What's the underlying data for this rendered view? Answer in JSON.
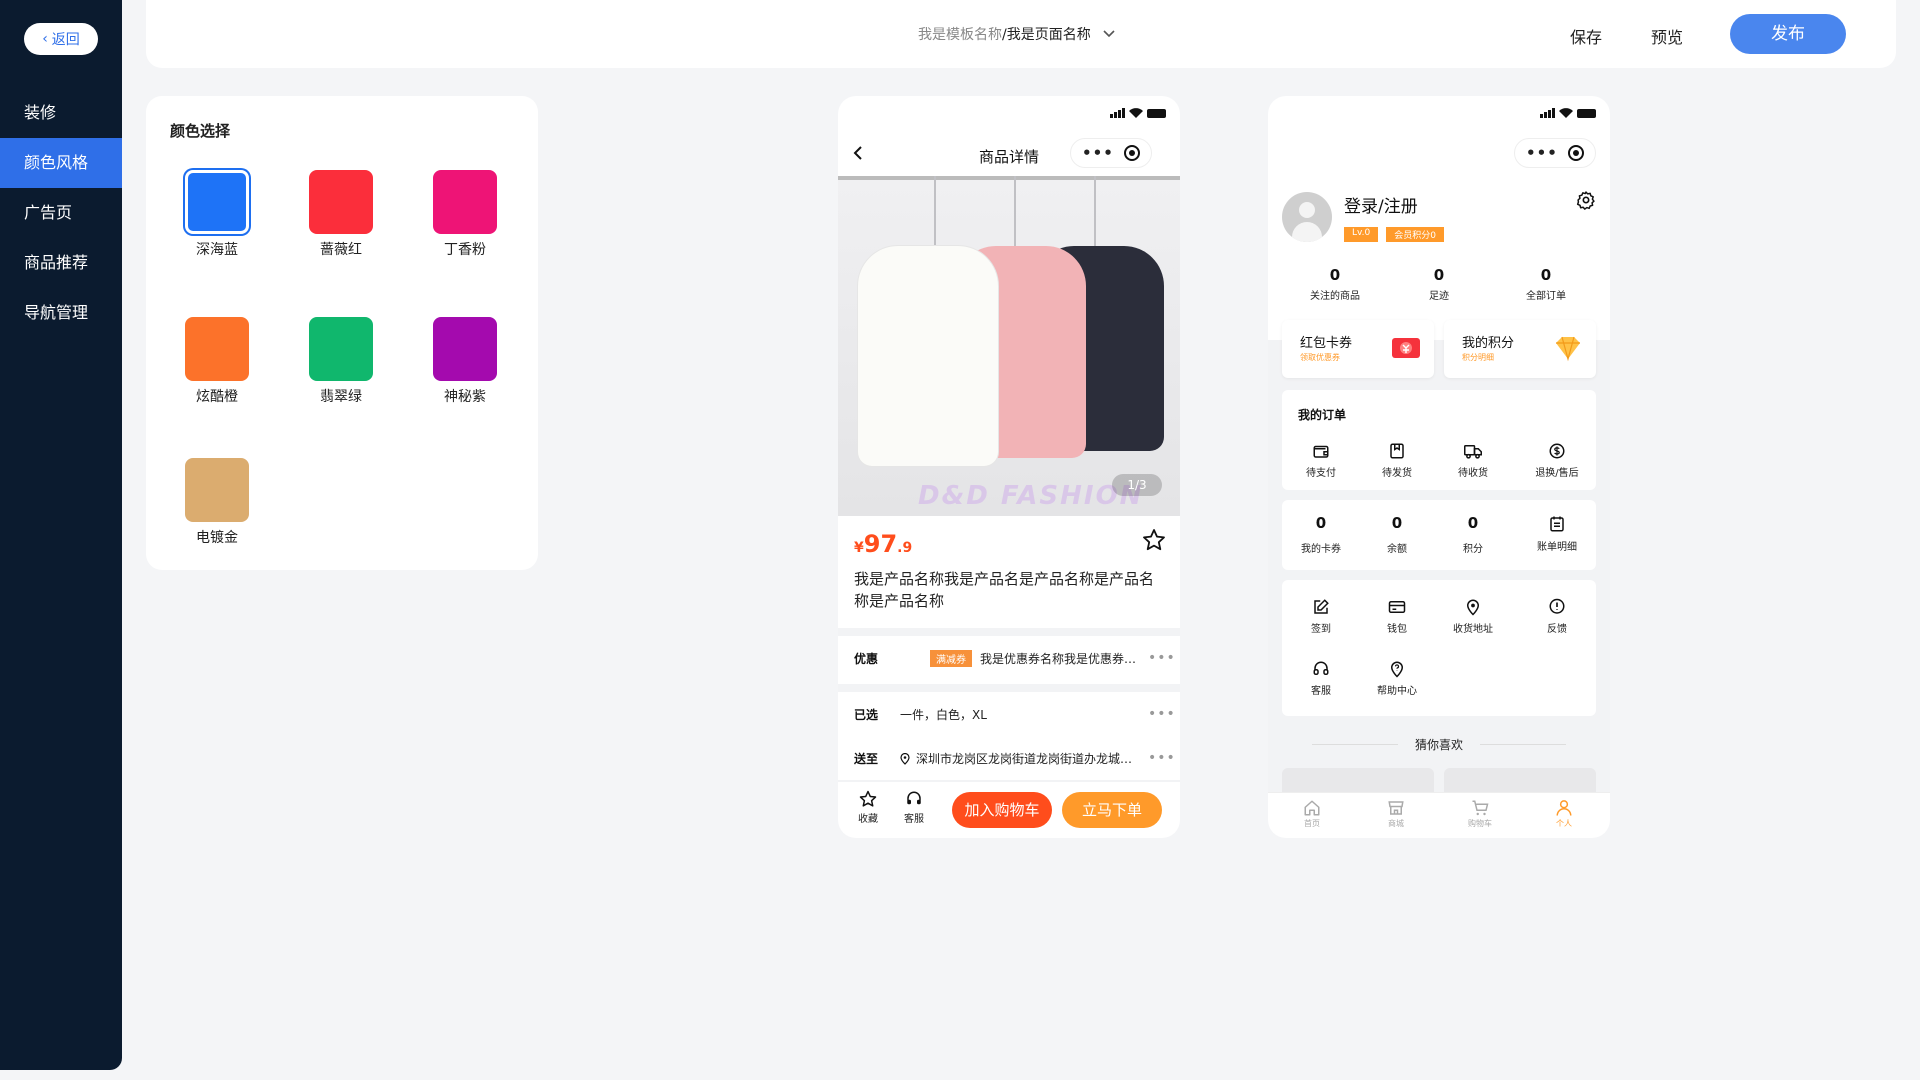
{
  "sidebar": {
    "back_label": "返回",
    "items": [
      {
        "label": "装修"
      },
      {
        "label": "颜色风格",
        "active": true
      },
      {
        "label": "广告页"
      },
      {
        "label": "商品推荐"
      },
      {
        "label": "导航管理"
      }
    ]
  },
  "header": {
    "template_name": "我是模板名称",
    "separator_page": "/我是页面名称",
    "save_label": "保存",
    "preview_label": "预览",
    "publish_label": "发布"
  },
  "color_panel": {
    "title": "颜色选择",
    "selected": "深海蓝",
    "colors": [
      {
        "name": "深海蓝",
        "hex": "#1e73f7"
      },
      {
        "name": "蔷薇红",
        "hex": "#fb2e3b"
      },
      {
        "name": "丁香粉",
        "hex": "#ee1476"
      },
      {
        "name": "炫酷橙",
        "hex": "#fc722a"
      },
      {
        "name": "翡翠绿",
        "hex": "#10b76d"
      },
      {
        "name": "神秘紫",
        "hex": "#a40aae"
      },
      {
        "name": "电镀金",
        "hex": "#dbac6f"
      }
    ]
  },
  "product_page": {
    "title": "商品详情",
    "image_caption": "D&D FASHION",
    "pager": "1/3",
    "price": {
      "currency": "¥",
      "integer": "97",
      "decimal": ".9"
    },
    "name": "我是产品名称我是产品名是产品名称是产品名称是产品名称",
    "promo_label": "优惠",
    "promo_tag": "满减券",
    "promo_text": "我是优惠券名称我是优惠券名称",
    "selected_label": "已选",
    "selected_text": "一件，白色，XL",
    "ship_label": "送至",
    "ship_text": "深圳市龙岗区龙岗街道龙岗街道办龙城广场",
    "fav_label": "收藏",
    "service_label": "客服",
    "cart_button": "加入购物车",
    "buy_button": "立马下单"
  },
  "profile_page": {
    "login_label": "登录/注册",
    "level_badge": "Lv.0",
    "points_badge": "会员积分0",
    "stats": [
      {
        "value": "0",
        "label": "关注的商品"
      },
      {
        "value": "0",
        "label": "足迹"
      },
      {
        "value": "0",
        "label": "全部订单"
      }
    ],
    "cards": [
      {
        "title": "红包卡券",
        "sub": "领取优惠券"
      },
      {
        "title": "我的积分",
        "sub": "积分明细"
      }
    ],
    "orders_title": "我的订单",
    "orders": [
      {
        "label": "待支付",
        "icon": "wallet-icon"
      },
      {
        "label": "待发货",
        "icon": "box-icon"
      },
      {
        "label": "待收货",
        "icon": "truck-icon"
      },
      {
        "label": "退换/售后",
        "icon": "dollar-icon"
      }
    ],
    "assets": [
      {
        "value": "0",
        "label": "我的卡券"
      },
      {
        "value": "0",
        "label": "余额"
      },
      {
        "value": "0",
        "label": "积分"
      },
      {
        "label": "账单明细",
        "icon": "calendar-icon"
      }
    ],
    "services": [
      {
        "label": "签到",
        "icon": "edit-icon"
      },
      {
        "label": "钱包",
        "icon": "card-icon"
      },
      {
        "label": "收货地址",
        "icon": "location-icon"
      },
      {
        "label": "反馈",
        "icon": "info-icon"
      },
      {
        "label": "客服",
        "icon": "headset-icon"
      },
      {
        "label": "帮助中心",
        "icon": "help-pin-icon"
      }
    ],
    "guess_title": "猜你喜欢",
    "tabs": [
      {
        "label": "首页",
        "icon": "home-icon"
      },
      {
        "label": "商城",
        "icon": "store-icon"
      },
      {
        "label": "购物车",
        "icon": "cart-icon"
      },
      {
        "label": "个人",
        "icon": "user-icon",
        "active": true
      }
    ]
  },
  "colors": {
    "accent": "#2f6fe8",
    "sidebar_bg": "#0b1b2f",
    "orange": "#ff9a2a",
    "red_orange": "#ff4d1c"
  }
}
